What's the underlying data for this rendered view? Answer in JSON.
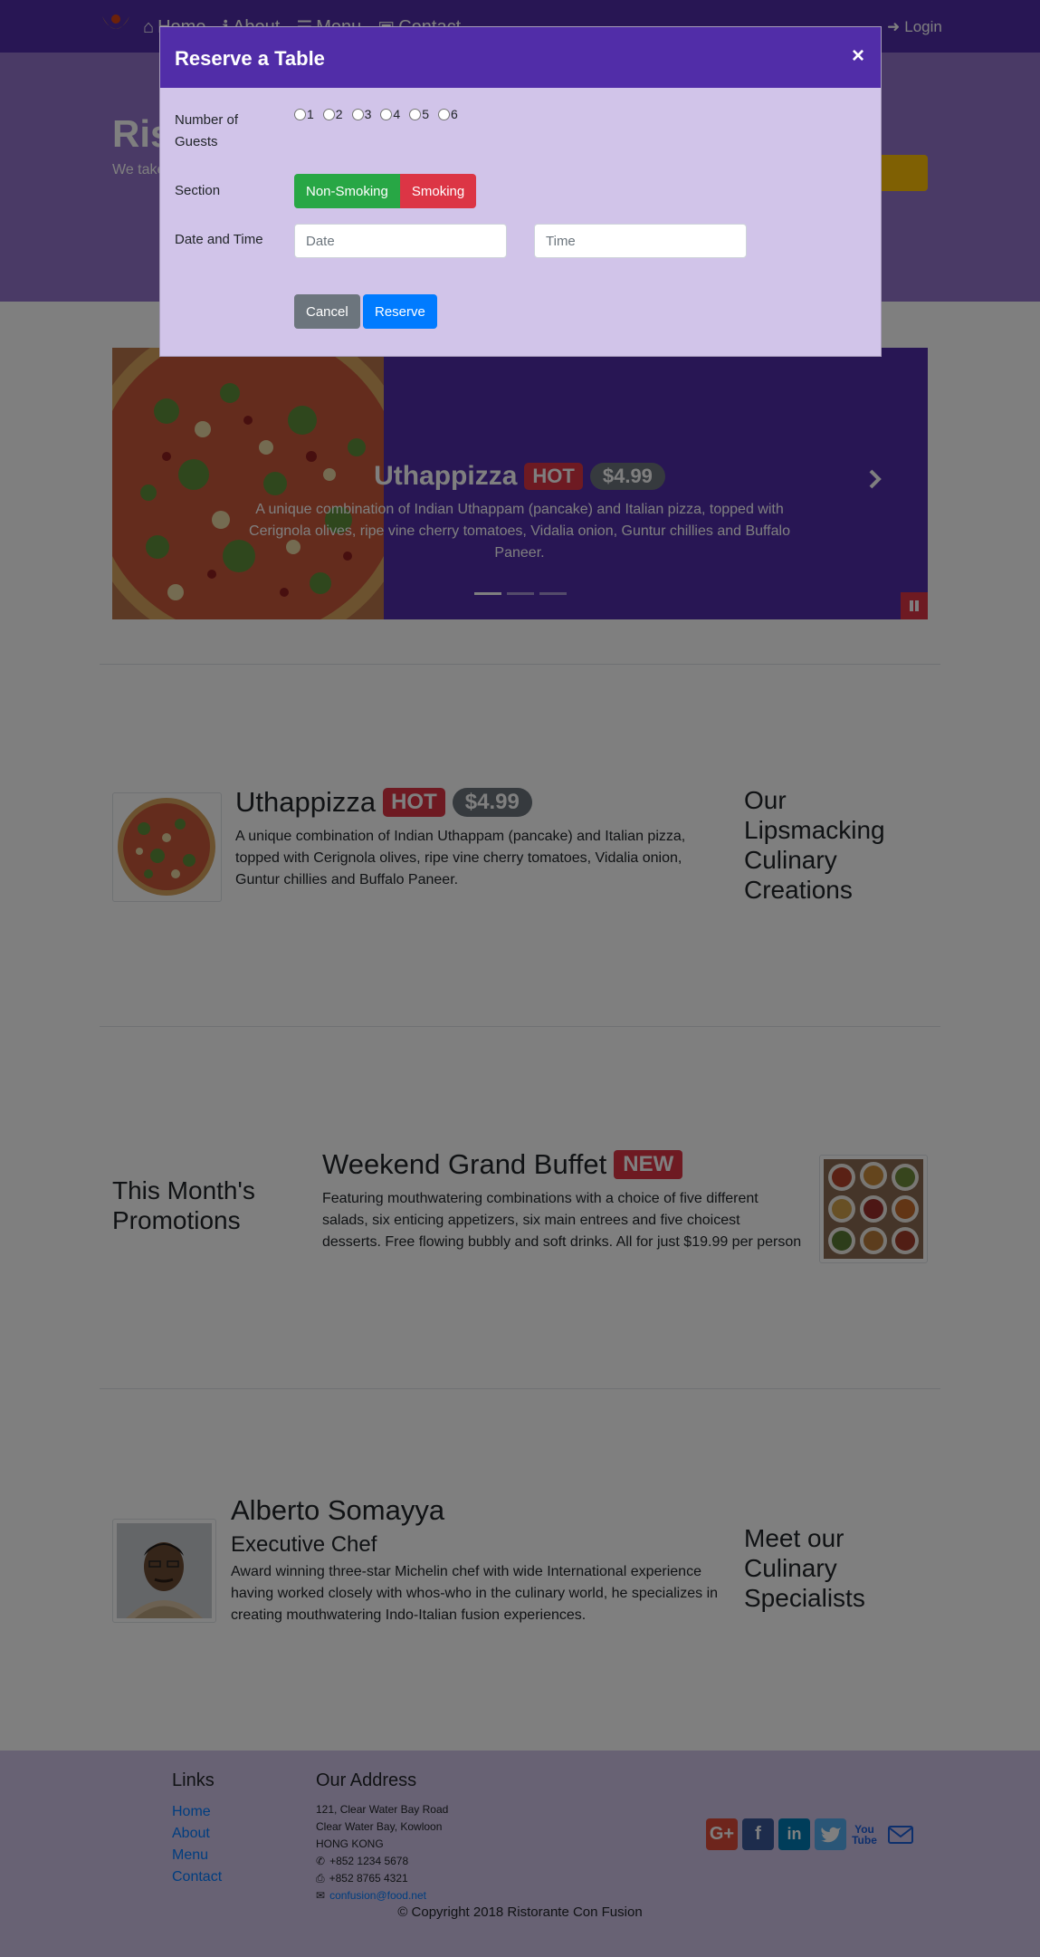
{
  "nav": {
    "items": [
      {
        "label": "Home",
        "icon": "home-icon"
      },
      {
        "label": "About",
        "icon": "info-icon"
      },
      {
        "label": "Menu",
        "icon": "list-icon"
      },
      {
        "label": "Contact",
        "icon": "address-card-icon"
      }
    ],
    "login_label": "Login"
  },
  "jumbotron": {
    "title": "Ris",
    "text": "We take... a uniqu... tickle y..."
  },
  "carousel": {
    "title": "Uthappizza",
    "badge": "HOT",
    "price": "$4.99",
    "description": "A unique combination of Indian Uthappam (pancake) and Italian pizza, topped with Cerignola olives, ripe vine cherry tomatoes, Vidalia onion, Guntur chillies and Buffalo Paneer.",
    "active_slide": 1,
    "slide_count": 3
  },
  "dish": {
    "title": "Uthappizza",
    "badge": "HOT",
    "price": "$4.99",
    "description": "A unique combination of Indian Uthappam (pancake) and Italian pizza, topped with Cerignola olives, ripe vine cherry tomatoes, Vidalia onion, Guntur chillies and Buffalo Paneer.",
    "side_heading": "Our Lipsmacking Culinary Creations"
  },
  "promotion": {
    "side_heading": "This Month's Promotions",
    "title": "Weekend Grand Buffet",
    "badge": "NEW",
    "description": "Featuring mouthwatering combinations with a choice of five different salads, six enticing appetizers, six main entrees and five choicest desserts. Free flowing bubbly and soft drinks. All for just $19.99 per person"
  },
  "leader": {
    "name": "Alberto Somayya",
    "designation": "Executive Chef",
    "description": "Award winning three-star Michelin chef with wide International experience having worked closely with whos-who in the culinary world, he specializes in creating mouthwatering Indo-Italian fusion experiences.",
    "side_heading": "Meet our Culinary Specialists"
  },
  "footer": {
    "links_title": "Links",
    "links": [
      "Home",
      "About",
      "Menu",
      "Contact"
    ],
    "address_title": "Our Address",
    "address_lines": [
      "121, Clear Water Bay Road",
      "Clear Water Bay, Kowloon",
      "HONG KONG"
    ],
    "phone": "+852 1234 5678",
    "fax": "+852 8765 4321",
    "email": "confusion@food.net",
    "social": [
      "google-plus-icon",
      "facebook-icon",
      "linkedin-icon",
      "twitter-icon",
      "youtube-icon",
      "mail-icon"
    ],
    "copyright": "© Copyright 2018 Ristorante Con Fusion"
  },
  "modal": {
    "title": "Reserve a Table",
    "close_label": "×",
    "guests_label": "Number of Guests",
    "guest_options": [
      "1",
      "2",
      "3",
      "4",
      "5",
      "6"
    ],
    "section_label": "Section",
    "section_options": [
      "Non-Smoking",
      "Smoking"
    ],
    "datetime_label": "Date and Time",
    "date_placeholder": "Date",
    "time_placeholder": "Time",
    "cancel_label": "Cancel",
    "reserve_label": "Reserve"
  },
  "colors": {
    "primary": "#512DA8",
    "primary_light": "#9575CD",
    "modal_body": "#D1C4E9",
    "success": "#28a745",
    "danger": "#dc3545",
    "link": "#007bff"
  }
}
